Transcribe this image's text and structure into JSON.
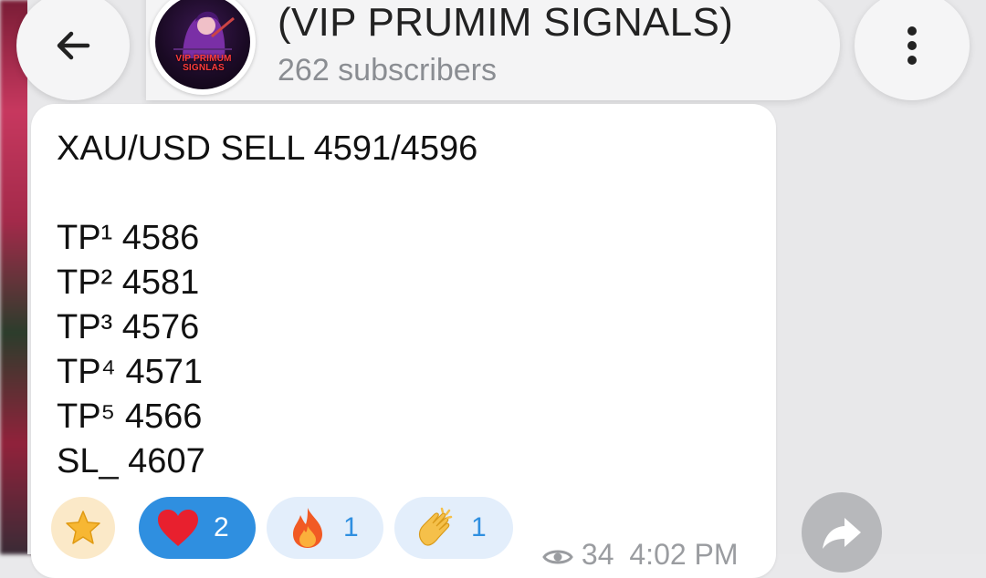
{
  "header": {
    "title": "(VIP PRUMIM SIGNALS)",
    "subtitle": "262 subscribers",
    "avatar_text": "VIP PRIMUM SIGNLAS",
    "back_icon": "arrow-left-icon",
    "menu_icon": "more-vertical-icon"
  },
  "message": {
    "lines": [
      "XAU/USD SELL 4591/4596",
      "TP¹ 4586",
      "TP² 4581",
      "TP³ 4576",
      "TP⁴ 4571",
      "TP⁵ 4566",
      "SL_ 4607"
    ],
    "views": "34",
    "time": "4:02 PM"
  },
  "reactions": [
    {
      "emoji": "star-icon",
      "count": ""
    },
    {
      "emoji": "heart-icon",
      "count": "2"
    },
    {
      "emoji": "fire-icon",
      "count": "1"
    },
    {
      "emoji": "clap-icon",
      "count": "1"
    }
  ],
  "colors": {
    "selected_reaction": "#2f8fe0",
    "reaction_bg": "#e3eefb",
    "star_reaction_bg": "#fbe9c8",
    "subtitle": "#8a8d92"
  }
}
